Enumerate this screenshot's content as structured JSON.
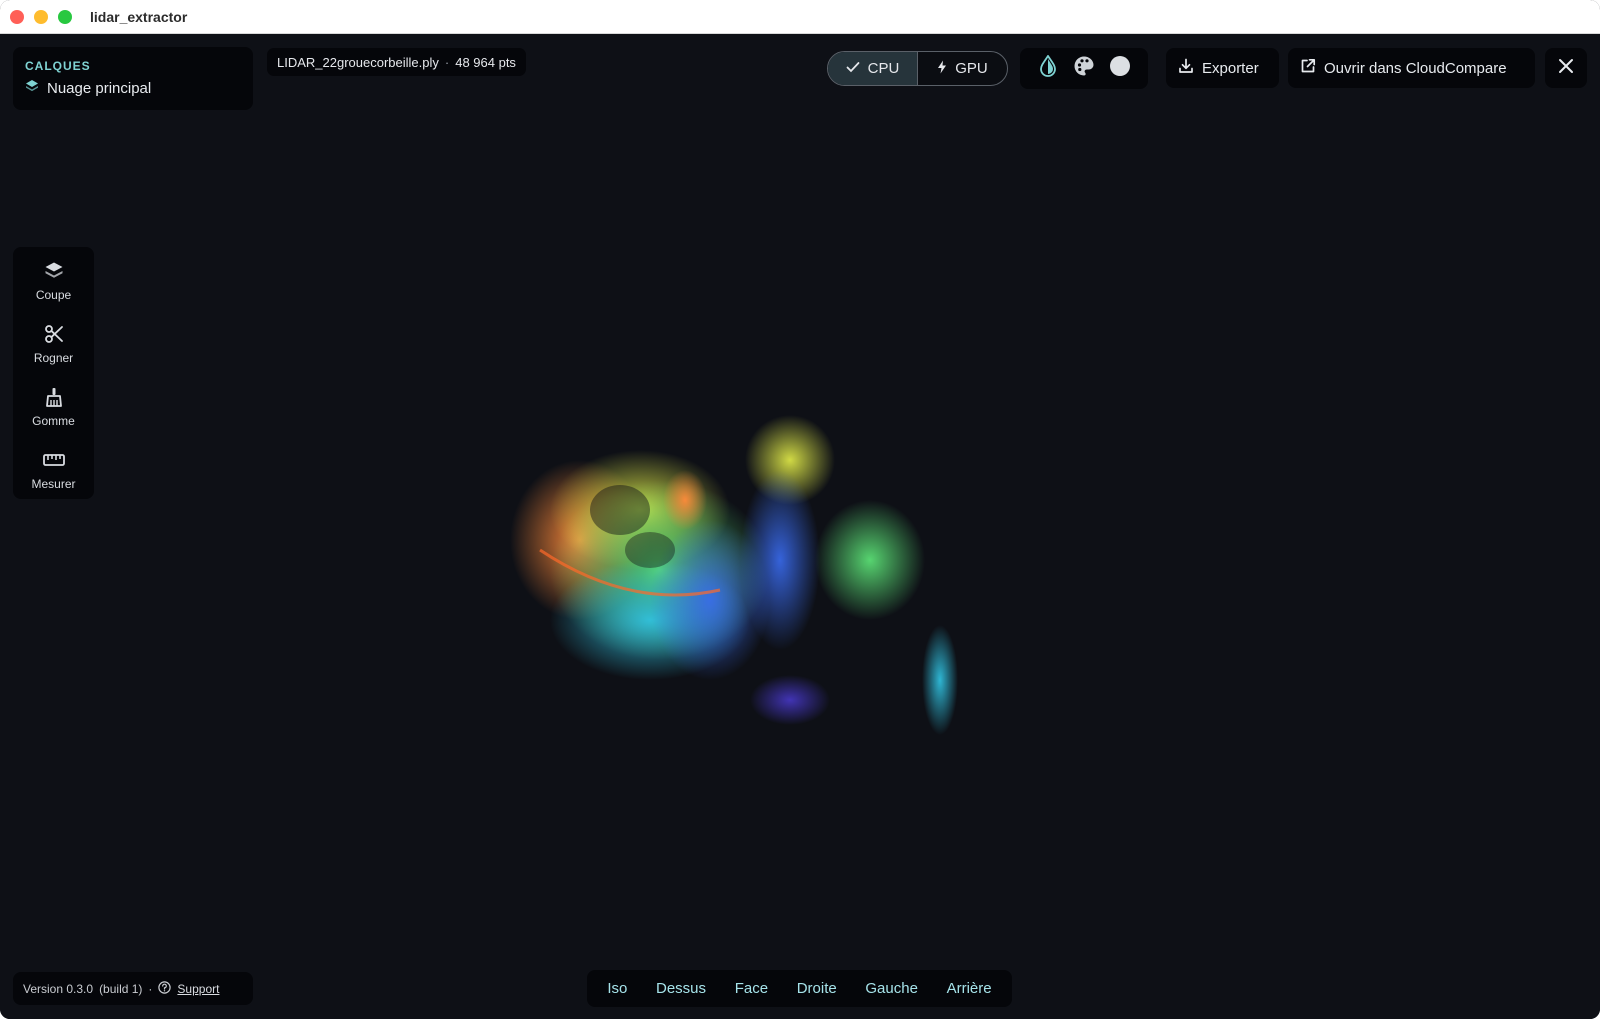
{
  "window": {
    "title": "lidar_extractor"
  },
  "layers": {
    "title": "CALQUES",
    "items": [
      {
        "label": "Nuage principal",
        "icon": "layers-icon"
      }
    ]
  },
  "file": {
    "name": "LIDAR_22grouecorbeille.ply",
    "separator": "·",
    "points": "48 964 pts"
  },
  "processing": {
    "options": [
      {
        "label": "CPU",
        "icon": "check-icon",
        "active": true
      },
      {
        "label": "GPU",
        "icon": "bolt-icon",
        "active": false
      }
    ]
  },
  "coloring": {
    "modes": [
      {
        "icon": "drop-icon",
        "color": "#7fd3d3"
      },
      {
        "icon": "palette-icon",
        "color": "#cfd3d8"
      },
      {
        "icon": "circle-icon",
        "color": "#dcdfe3"
      }
    ]
  },
  "actions": {
    "export_label": "Exporter",
    "open_label": "Ouvrir dans CloudCompare"
  },
  "tools": [
    {
      "label": "Coupe",
      "icon": "layers-icon"
    },
    {
      "label": "Rogner",
      "icon": "scissors-icon"
    },
    {
      "label": "Gomme",
      "icon": "broom-icon"
    },
    {
      "label": "Mesurer",
      "icon": "ruler-icon"
    }
  ],
  "footer": {
    "version": "Version 0.3.0",
    "build": "(build 1)",
    "separator": "·",
    "support": "Support"
  },
  "views": [
    "Iso",
    "Dessus",
    "Face",
    "Droite",
    "Gauche",
    "Arrière"
  ],
  "colors": {
    "accent": "#7fd3d3",
    "background": "#0e1016",
    "panel": "#05060a"
  }
}
